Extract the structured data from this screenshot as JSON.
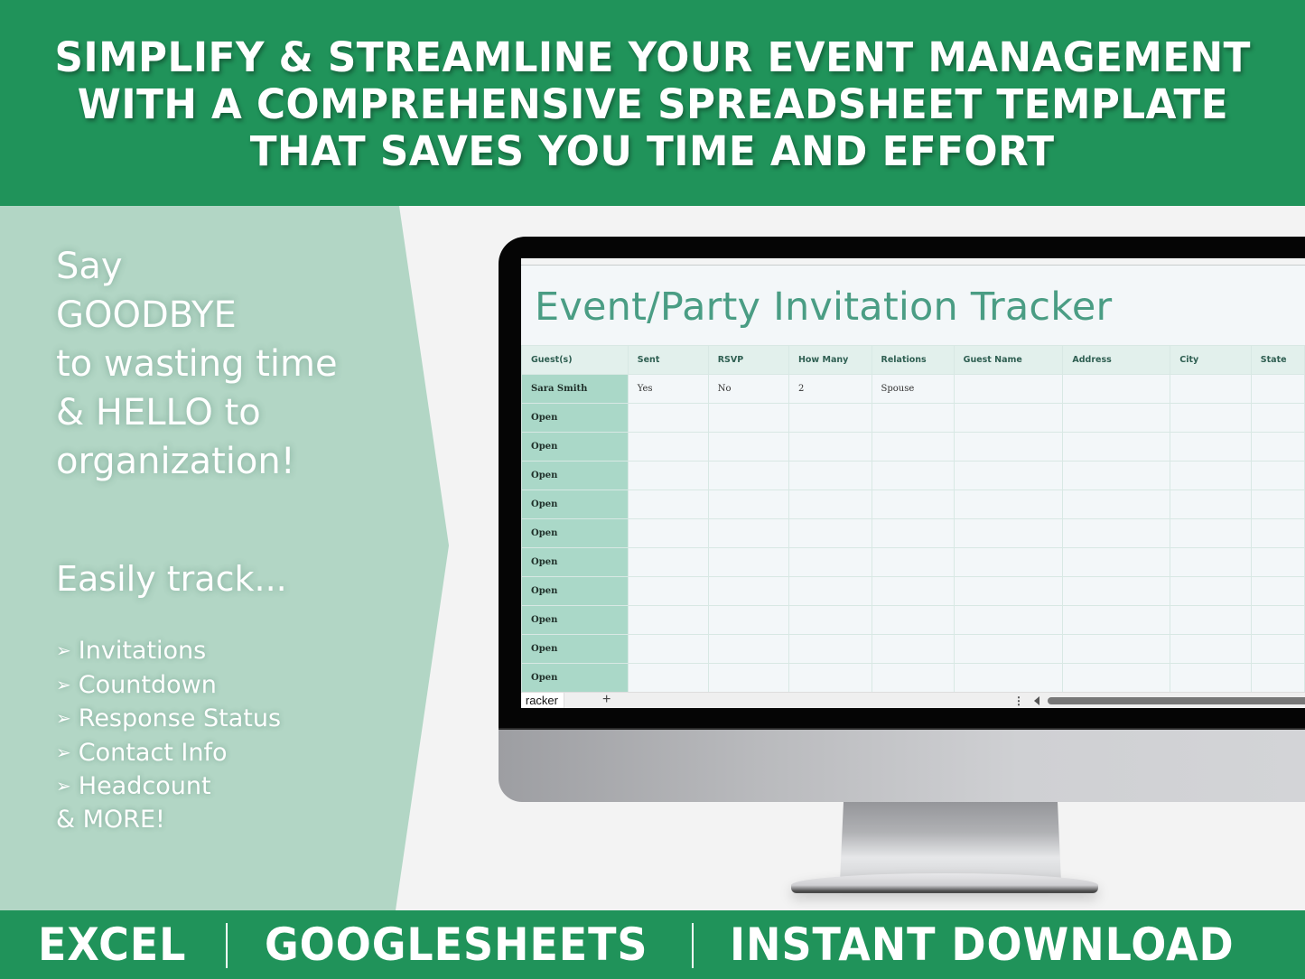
{
  "header": {
    "lines": [
      "SIMPLIFY & STREAMLINE YOUR EVENT MANAGEMENT",
      "WITH A COMPREHENSIVE SPREADSHEET TEMPLATE",
      "THAT SAVES YOU TIME AND EFFORT"
    ]
  },
  "left_panel": {
    "hero_lines": [
      "Say",
      "GOODBYE",
      "to wasting time",
      "& HELLO to",
      "organization!"
    ],
    "easily_track": "Easily track...",
    "bullet_glyph": "➢",
    "features": [
      "Invitations",
      "Countdown",
      "Response Status",
      "Contact Info",
      "Headcount"
    ],
    "more": "& MORE!"
  },
  "spreadsheet": {
    "title": "Event/Party Invitation Tracker",
    "columns": [
      "Guest(s)",
      "Sent",
      "RSVP",
      "How Many",
      "Relations",
      "Guest Name",
      "Address",
      "City",
      "State"
    ],
    "rows": [
      [
        "Sara Smith",
        "Yes",
        "No",
        "2",
        "Spouse",
        "",
        "",
        "",
        ""
      ],
      [
        "Open",
        "",
        "",
        "",
        "",
        "",
        "",
        "",
        ""
      ],
      [
        "Open",
        "",
        "",
        "",
        "",
        "",
        "",
        "",
        ""
      ],
      [
        "Open",
        "",
        "",
        "",
        "",
        "",
        "",
        "",
        ""
      ],
      [
        "Open",
        "",
        "",
        "",
        "",
        "",
        "",
        "",
        ""
      ],
      [
        "Open",
        "",
        "",
        "",
        "",
        "",
        "",
        "",
        ""
      ],
      [
        "Open",
        "",
        "",
        "",
        "",
        "",
        "",
        "",
        ""
      ],
      [
        "Open",
        "",
        "",
        "",
        "",
        "",
        "",
        "",
        ""
      ],
      [
        "Open",
        "",
        "",
        "",
        "",
        "",
        "",
        "",
        ""
      ],
      [
        "Open",
        "",
        "",
        "",
        "",
        "",
        "",
        "",
        ""
      ],
      [
        "Open",
        "",
        "",
        "",
        "",
        "",
        "",
        "",
        ""
      ]
    ],
    "active_tab": "racker",
    "add_sheet_glyph": "+",
    "menu_glyph": "⋮"
  },
  "footer": {
    "items": [
      "EXCEL",
      "GOOGLESHEETS",
      "INSTANT DOWNLOAD"
    ]
  },
  "colors": {
    "brand_green": "#20935a",
    "panel_mint": "#b2d6c5",
    "title_teal": "#4a9d84",
    "guest_col": "#aad8c8",
    "header_row": "#e2f0ec"
  }
}
